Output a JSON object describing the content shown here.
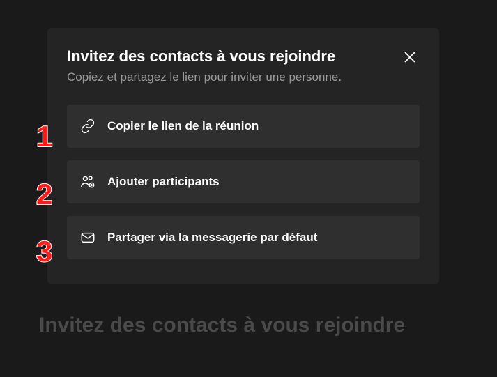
{
  "dialog": {
    "title": "Invitez des contacts à vous rejoindre",
    "subtitle": "Copiez et partagez le lien pour inviter une personne.",
    "options": [
      {
        "label": "Copier le lien de la réunion",
        "step": "1"
      },
      {
        "label": "Ajouter participants",
        "step": "2"
      },
      {
        "label": "Partager via la messagerie par défaut",
        "step": "3"
      }
    ]
  },
  "footer": "Invitez des contacts à vous rejoindre"
}
